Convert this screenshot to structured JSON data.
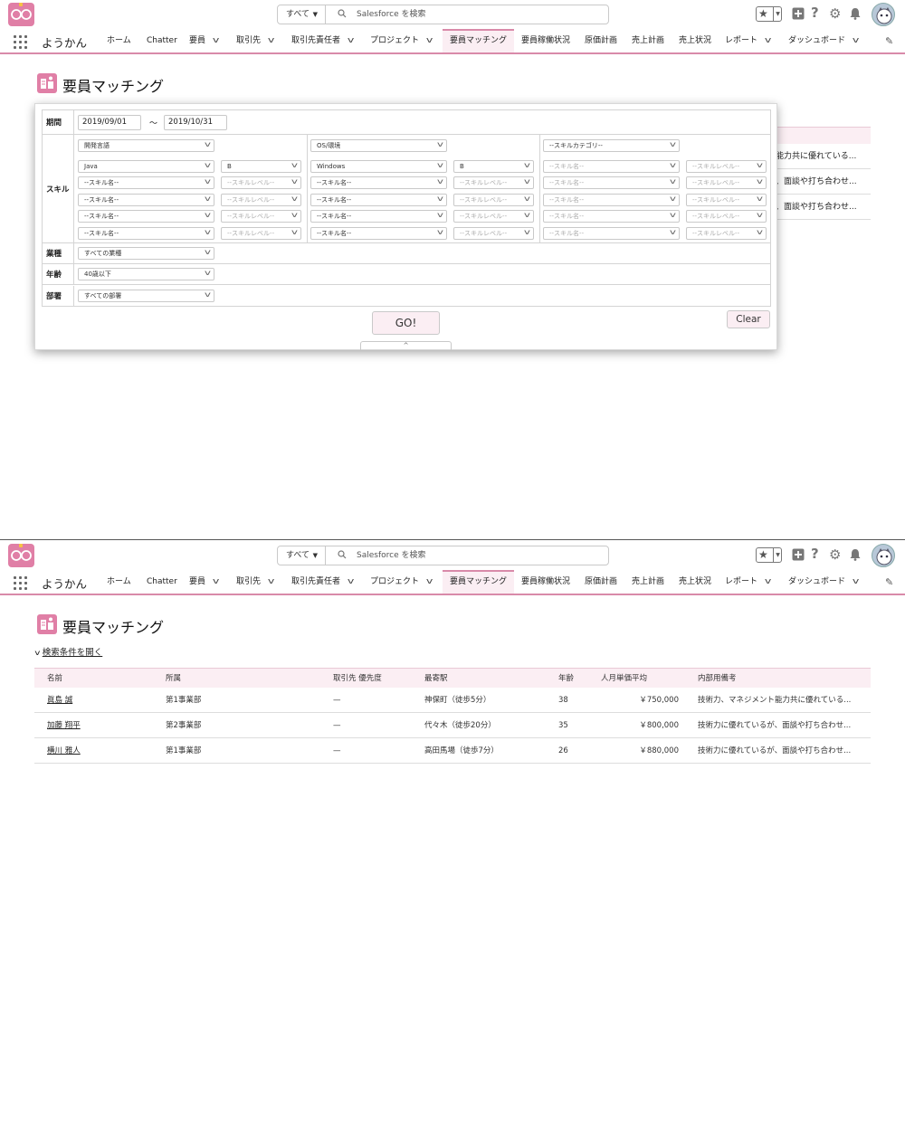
{
  "header": {
    "search_scope": "すべて",
    "search_placeholder": "Salesforce を検索"
  },
  "nav": {
    "app_name": "ようかん",
    "items": [
      {
        "label": "ホーム",
        "dropdown": false
      },
      {
        "label": "Chatter",
        "dropdown": false
      },
      {
        "label": "要員",
        "dropdown": true
      },
      {
        "label": "取引先",
        "dropdown": true
      },
      {
        "label": "取引先責任者",
        "dropdown": true
      },
      {
        "label": "プロジェクト",
        "dropdown": true
      },
      {
        "label": "要員マッチング",
        "dropdown": false,
        "active": true
      },
      {
        "label": "要員稼働状況",
        "dropdown": false
      },
      {
        "label": "原価計画",
        "dropdown": false
      },
      {
        "label": "売上計画",
        "dropdown": false
      },
      {
        "label": "売上状況",
        "dropdown": false
      },
      {
        "label": "レポート",
        "dropdown": true
      },
      {
        "label": "ダッシュボード",
        "dropdown": true
      }
    ]
  },
  "page": {
    "title": "要員マッチング"
  },
  "search_form": {
    "period": {
      "label": "期間",
      "from": "2019/09/01",
      "separator": "～",
      "to": "2019/10/31"
    },
    "skill": {
      "label": "スキル",
      "categories": [
        "開発言語",
        "OS/環境",
        "--スキルカテゴリ--"
      ],
      "groups": [
        {
          "rows": [
            {
              "name": "Java",
              "level": "B"
            },
            {
              "name": "--スキル名--",
              "level": "--スキルレベル--"
            },
            {
              "name": "--スキル名--",
              "level": "--スキルレベル--"
            },
            {
              "name": "--スキル名--",
              "level": "--スキルレベル--"
            },
            {
              "name": "--スキル名--",
              "level": "--スキルレベル--"
            }
          ]
        },
        {
          "rows": [
            {
              "name": "Windows",
              "level": "B"
            },
            {
              "name": "--スキル名--",
              "level": "--スキルレベル--"
            },
            {
              "name": "--スキル名--",
              "level": "--スキルレベル--"
            },
            {
              "name": "--スキル名--",
              "level": "--スキルレベル--"
            },
            {
              "name": "--スキル名--",
              "level": "--スキルレベル--"
            }
          ]
        },
        {
          "rows": [
            {
              "name": "--スキル名--",
              "level": "--スキルレベル--"
            },
            {
              "name": "--スキル名--",
              "level": "--スキルレベル--"
            },
            {
              "name": "--スキル名--",
              "level": "--スキルレベル--"
            },
            {
              "name": "--スキル名--",
              "level": "--スキルレベル--"
            },
            {
              "name": "--スキル名--",
              "level": "--スキルレベル--"
            }
          ]
        }
      ]
    },
    "industry": {
      "label": "業種",
      "value": "すべての業種"
    },
    "age": {
      "label": "年齢",
      "value": "40歳以下"
    },
    "department": {
      "label": "部署",
      "value": "すべての部署"
    },
    "go_label": "GO!",
    "clear_label": "Clear",
    "collapse_glyph": "^"
  },
  "results": {
    "toggle_label": "検索条件を開く",
    "columns": [
      "名前",
      "所属",
      "取引先 優先度",
      "最寄駅",
      "年齢",
      "人月単価平均",
      "内部用備考"
    ],
    "rows": [
      {
        "name": "眞島 誠",
        "dept": "第1事業部",
        "priority": "—",
        "station": "神保町（徒歩5分）",
        "age": "38",
        "rate": "￥750,000",
        "remark": "技術力、マネジメント能力共に優れている..."
      },
      {
        "name": "加藤 翔平",
        "dept": "第2事業部",
        "priority": "—",
        "station": "代々木（徒歩20分）",
        "age": "35",
        "rate": "￥800,000",
        "remark": "技術力に優れているが、面談や打ち合わせ..."
      },
      {
        "name": "横川 雅人",
        "dept": "第1事業部",
        "priority": "—",
        "station": "高田馬場（徒歩7分）",
        "age": "26",
        "rate": "￥880,000",
        "remark": "技術力に優れているが、面談や打ち合わせ..."
      }
    ],
    "peek_remarks": [
      "能力共に優れている...",
      "、面談や打ち合わせ...",
      "、面談や打ち合わせ..."
    ]
  },
  "icons": {
    "logo": "glasses-logo-icon",
    "search": "search-icon",
    "favorites": "star-icon",
    "add": "plus-icon",
    "help": "question-icon",
    "settings": "gear-icon",
    "notifications": "bell-icon",
    "avatar": "user-avatar-icon",
    "app_launcher": "waffle-icon",
    "edit_nav": "pencil-icon"
  },
  "colors": {
    "accent": "#e07fa6",
    "accent_light": "#fbeef3",
    "nav_border": "#d98aa9"
  }
}
